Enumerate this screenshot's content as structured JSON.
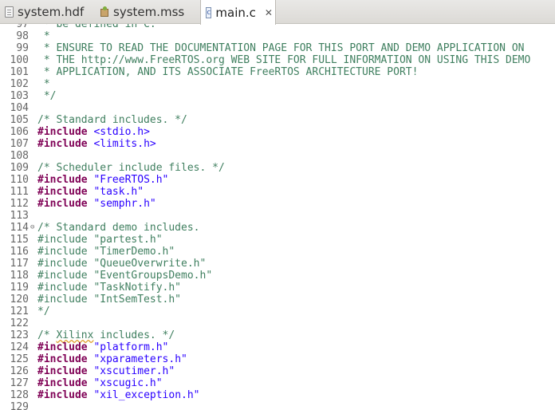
{
  "tabs": [
    {
      "label": "system.hdf",
      "icon": "hdf-file-icon",
      "active": false
    },
    {
      "label": "system.mss",
      "icon": "mss-file-icon",
      "active": false
    },
    {
      "label": "main.c",
      "icon": "c-source-file-icon",
      "active": true,
      "close": "✕"
    }
  ],
  "c_icon_glyph": "c",
  "lines": [
    {
      "n": "97",
      "parts": [
        {
          "t": " * be defined in C.",
          "c": "c"
        }
      ]
    },
    {
      "n": "98",
      "parts": [
        {
          "t": " *",
          "c": "c"
        }
      ]
    },
    {
      "n": "99",
      "parts": [
        {
          "t": " * ENSURE TO READ THE DOCUMENTATION PAGE FOR THIS PORT AND DEMO APPLICATION ON",
          "c": "c"
        }
      ]
    },
    {
      "n": "100",
      "parts": [
        {
          "t": " * THE http://www.FreeRTOS.org WEB SITE FOR FULL INFORMATION ON USING THIS DEMO",
          "c": "c"
        }
      ]
    },
    {
      "n": "101",
      "parts": [
        {
          "t": " * APPLICATION, AND ITS ASSOCIATE FreeRTOS ARCHITECTURE PORT!",
          "c": "c"
        }
      ]
    },
    {
      "n": "102",
      "parts": [
        {
          "t": " *",
          "c": "c"
        }
      ]
    },
    {
      "n": "103",
      "parts": [
        {
          "t": " */",
          "c": "c"
        }
      ]
    },
    {
      "n": "104",
      "parts": []
    },
    {
      "n": "105",
      "parts": [
        {
          "t": "/* Standard includes. */",
          "c": "c"
        }
      ]
    },
    {
      "n": "106",
      "parts": [
        {
          "t": "#include",
          "c": "k"
        },
        {
          "t": " "
        },
        {
          "t": "<stdio.h>",
          "c": "s"
        }
      ]
    },
    {
      "n": "107",
      "parts": [
        {
          "t": "#include",
          "c": "k"
        },
        {
          "t": " "
        },
        {
          "t": "<limits.h>",
          "c": "s"
        }
      ]
    },
    {
      "n": "108",
      "parts": []
    },
    {
      "n": "109",
      "parts": [
        {
          "t": "/* Scheduler include files. */",
          "c": "c"
        }
      ]
    },
    {
      "n": "110",
      "parts": [
        {
          "t": "#include",
          "c": "k"
        },
        {
          "t": " "
        },
        {
          "t": "\"FreeRTOS.h\"",
          "c": "s"
        }
      ]
    },
    {
      "n": "111",
      "parts": [
        {
          "t": "#include",
          "c": "k"
        },
        {
          "t": " "
        },
        {
          "t": "\"task.h\"",
          "c": "s"
        }
      ]
    },
    {
      "n": "112",
      "parts": [
        {
          "t": "#include",
          "c": "k"
        },
        {
          "t": " "
        },
        {
          "t": "\"semphr.h\"",
          "c": "s"
        }
      ]
    },
    {
      "n": "113",
      "parts": []
    },
    {
      "n": "114",
      "fold": "⊖",
      "parts": [
        {
          "t": "/* Standard demo includes.",
          "c": "c"
        }
      ]
    },
    {
      "n": "115",
      "parts": [
        {
          "t": "#include \"partest.h\"",
          "c": "c"
        }
      ]
    },
    {
      "n": "116",
      "parts": [
        {
          "t": "#include \"TimerDemo.h\"",
          "c": "c"
        }
      ]
    },
    {
      "n": "117",
      "parts": [
        {
          "t": "#include \"QueueOverwrite.h\"",
          "c": "c"
        }
      ]
    },
    {
      "n": "118",
      "parts": [
        {
          "t": "#include \"EventGroupsDemo.h\"",
          "c": "c"
        }
      ]
    },
    {
      "n": "119",
      "parts": [
        {
          "t": "#include \"TaskNotify.h\"",
          "c": "c"
        }
      ]
    },
    {
      "n": "120",
      "parts": [
        {
          "t": "#include \"IntSemTest.h\"",
          "c": "c"
        }
      ]
    },
    {
      "n": "121",
      "parts": [
        {
          "t": "*/",
          "c": "c"
        }
      ]
    },
    {
      "n": "122",
      "parts": []
    },
    {
      "n": "123",
      "parts": [
        {
          "t": "/* ",
          "c": "c"
        },
        {
          "t": "Xilinx",
          "c": "c sq"
        },
        {
          "t": " includes. */",
          "c": "c"
        }
      ]
    },
    {
      "n": "124",
      "parts": [
        {
          "t": "#include",
          "c": "k"
        },
        {
          "t": " "
        },
        {
          "t": "\"platform.h\"",
          "c": "s"
        }
      ]
    },
    {
      "n": "125",
      "parts": [
        {
          "t": "#include",
          "c": "k"
        },
        {
          "t": " "
        },
        {
          "t": "\"xparameters.h\"",
          "c": "s"
        }
      ]
    },
    {
      "n": "126",
      "parts": [
        {
          "t": "#include",
          "c": "k"
        },
        {
          "t": " "
        },
        {
          "t": "\"xscutimer.h\"",
          "c": "s"
        }
      ]
    },
    {
      "n": "127",
      "parts": [
        {
          "t": "#include",
          "c": "k"
        },
        {
          "t": " "
        },
        {
          "t": "\"xscugic.h\"",
          "c": "s"
        }
      ]
    },
    {
      "n": "128",
      "parts": [
        {
          "t": "#include",
          "c": "k"
        },
        {
          "t": " "
        },
        {
          "t": "\"xil_exception.h\"",
          "c": "s"
        }
      ]
    },
    {
      "n": "129",
      "parts": []
    }
  ]
}
